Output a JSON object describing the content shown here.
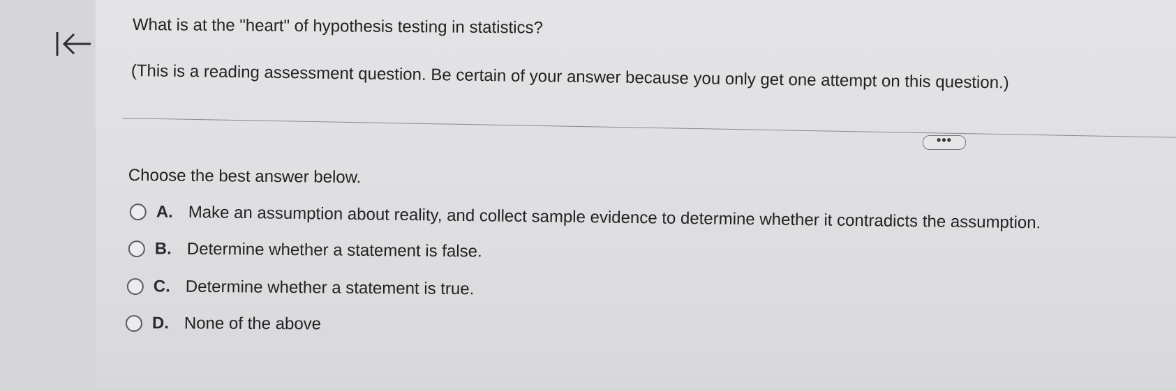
{
  "question": {
    "text": "What is at the \"heart\" of hypothesis testing in statistics?",
    "instruction": "(This is a reading assessment question.  Be certain of your answer because you only get one attempt on this question.)"
  },
  "expand_label": "•••",
  "prompt": "Choose the best answer below.",
  "options": [
    {
      "letter": "A.",
      "text": "Make an assumption about reality, and collect sample evidence to determine whether it contradicts the assumption."
    },
    {
      "letter": "B.",
      "text": "Determine whether a statement is false."
    },
    {
      "letter": "C.",
      "text": "Determine whether a statement is true."
    },
    {
      "letter": "D.",
      "text": "None of the above"
    }
  ],
  "colors": {
    "topbar": "#0b6c8e",
    "background": "#e2e2e5"
  }
}
